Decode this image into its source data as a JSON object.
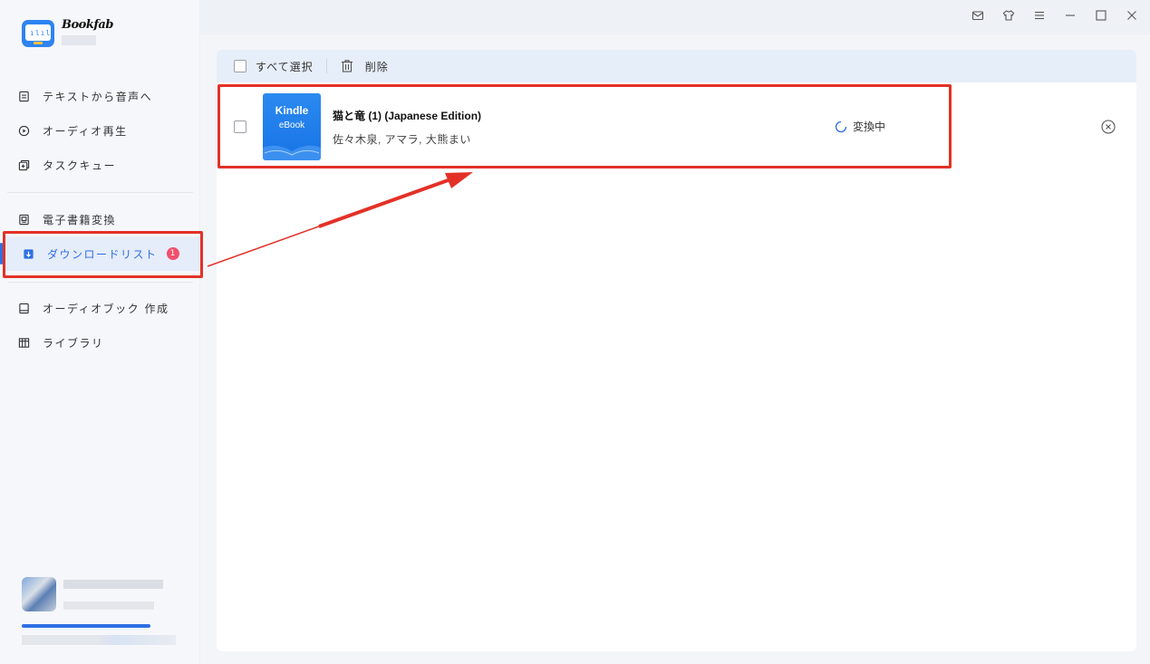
{
  "app": {
    "name": "Bookfab"
  },
  "sidebar": {
    "items": [
      {
        "label": "テキストから音声へ",
        "icon": "document-icon"
      },
      {
        "label": "オーディオ再生",
        "icon": "play-circle-icon"
      },
      {
        "label": "タスクキュー",
        "icon": "task-queue-icon"
      },
      {
        "label": "電子書籍変換",
        "icon": "ebook-convert-icon"
      },
      {
        "label": "ダウンロードリスト",
        "icon": "download-icon",
        "badge": "1",
        "active": true
      },
      {
        "label": "オーディオブック 作成",
        "icon": "audiobook-icon"
      },
      {
        "label": "ライブラリ",
        "icon": "library-icon"
      }
    ]
  },
  "titlebar": {
    "icons": [
      "mail-icon",
      "shirt-icon",
      "menu-icon",
      "minimize-icon",
      "maximize-icon",
      "close-icon"
    ]
  },
  "toolbar": {
    "select_all_label": "すべて選択",
    "delete_label": "削除"
  },
  "downloads": [
    {
      "cover_line1": "Kindle",
      "cover_line2": "eBook",
      "title": "猫と竜 (1) (Japanese Edition)",
      "author": "佐々木泉, アマラ, 大熊まい",
      "status": "変換中"
    }
  ],
  "colors": {
    "accent": "#2e6fe3",
    "highlight_annotation": "#e33127",
    "badge": "#f0506e",
    "cover": "#1773e6"
  }
}
